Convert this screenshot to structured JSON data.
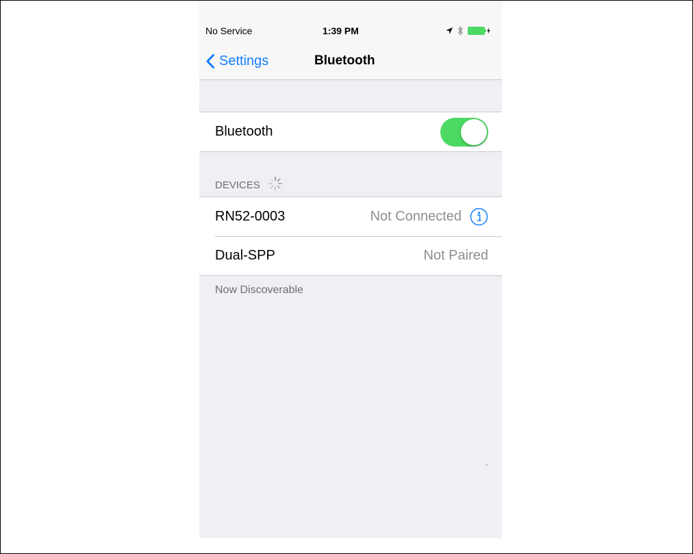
{
  "status_bar": {
    "carrier": "No Service",
    "time": "1:39 PM",
    "icons": [
      "location-arrow-icon",
      "bluetooth-icon",
      "battery-charging-icon"
    ]
  },
  "nav": {
    "back_label": "Settings",
    "title": "Bluetooth"
  },
  "bluetooth_row": {
    "label": "Bluetooth",
    "enabled": true
  },
  "devices_header": "DEVICES",
  "devices": [
    {
      "name": "RN52-0003",
      "status": "Not Connected",
      "has_info": true
    },
    {
      "name": "Dual-SPP",
      "status": "Not Paired",
      "has_info": false
    }
  ],
  "footer": "Now Discoverable",
  "colors": {
    "accent": "#147efb",
    "toggle_on": "#4cd964",
    "battery": "#4cd964",
    "background": "#efeff4"
  }
}
